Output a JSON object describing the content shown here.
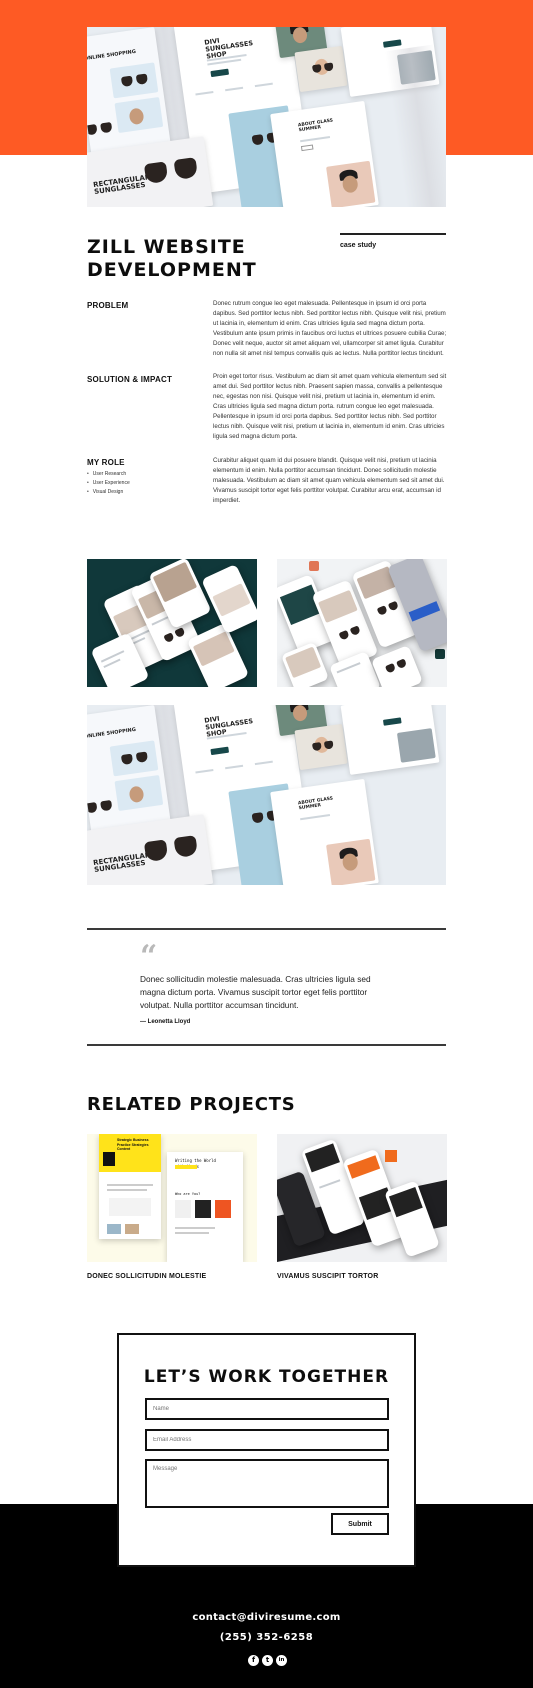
{
  "hero": {
    "mock_online_shopping": "ONLINE SHOPPING",
    "mock_shop_title": "DIVI SUNGLASSES SHOP",
    "mock_about": "ABOUT GLASS SUMMER",
    "mock_rect": "RECTANGULAR SUNGLASSES"
  },
  "project": {
    "title": "ZILL WEBSITE DEVELOPMENT",
    "tag": "case study"
  },
  "sections": {
    "problem": {
      "label": "PROBLEM",
      "text": "Donec rutrum congue leo eget malesuada. Pellentesque in ipsum id orci porta dapibus. Sed porttitor lectus nibh. Sed porttitor lectus nibh. Quisque velit nisi, pretium ut lacinia in, elementum id enim. Cras ultricies ligula sed magna dictum porta. Vestibulum ante ipsum primis in faucibus orci luctus et ultrices posuere cubilia Curae; Donec velit neque, auctor sit amet aliquam vel, ullamcorper sit amet ligula. Curabitur non nulla sit amet nisl tempus convallis quis ac lectus. Nulla porttitor lectus tincidunt."
    },
    "solution": {
      "label": "SOLUTION & IMPACT",
      "text": "Proin eget tortor risus. Vestibulum ac diam sit amet quam vehicula elementum sed sit amet dui. Sed porttitor lectus nibh. Praesent sapien massa, convallis a pellentesque nec, egestas non nisi. Quisque velit nisi, pretium ut lacinia in, elementum id enim. Cras ultricies ligula sed magna dictum porta. rutrum congue leo eget malesuada. Pellentesque in ipsum id orci porta dapibus. Sed porttitor lectus nibh. Sed porttitor lectus nibh. Quisque velit nisi, pretium ut lacinia in, elementum id enim. Cras ultricies ligula sed magna dictum porta."
    },
    "role": {
      "label": "MY ROLE",
      "items": [
        "User Research",
        "User Experience",
        "Visual Design"
      ],
      "text": "Curabitur aliquet quam id dui posuere blandit. Quisque velit nisi, pretium ut lacinia elementum id enim. Nulla porttitor accumsan tincidunt. Donec sollicitudin molestie malesuada. Vestibulum ac diam sit amet quam vehicula elementum sed sit amet dui. Vivamus suscipit tortor eget felis porttitor volutpat. Curabitur arcu erat, accumsan id imperdiet."
    }
  },
  "quote": {
    "mark": "“",
    "text": "Donec sollicitudin molestie malesuada. Cras ultricies ligula sed magna dictum porta. Vivamus suscipit tortor eget felis porttitor volutpat. Nulla porttitor accumsan tincidunt.",
    "author": "— Leonetta Lloyd"
  },
  "related": {
    "title": "RELATED PROJECTS",
    "projects": [
      {
        "label": "DONEC SOLLICITUDIN MOLESTIE",
        "mock_heading": "Strategic Business Practice Strategies Content",
        "mock_heading2": "Writing the World with Words",
        "mock_section": "Who are You?"
      },
      {
        "label": "VIVAMUS SUSCIPIT TORTOR"
      }
    ]
  },
  "contact": {
    "title": "LET’S WORK TOGETHER",
    "name_placeholder": "Name",
    "email_placeholder": "Email Address",
    "message_placeholder": "Message",
    "submit_label": "Submit"
  },
  "footer": {
    "email": "contact@diviresume.com",
    "phone": "(255) 352-6258",
    "socials": [
      {
        "icon": "facebook-icon",
        "glyph": "f"
      },
      {
        "icon": "twitter-icon",
        "glyph": "t"
      },
      {
        "icon": "linkedin-icon",
        "glyph": "in"
      }
    ]
  },
  "colors": {
    "accent": "#fe5a24",
    "dark_teal": "#133a3a",
    "footer_bg": "#000000"
  }
}
